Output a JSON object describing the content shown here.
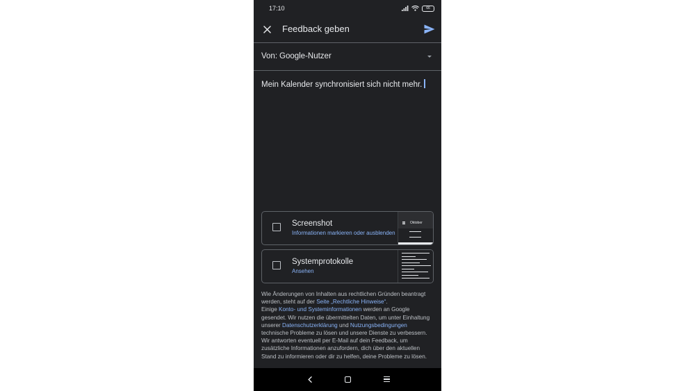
{
  "status_bar": {
    "time": "17:10",
    "battery": "66",
    "icons": [
      "signal-icon",
      "wifi-icon",
      "battery-icon"
    ]
  },
  "app_bar": {
    "close_icon": "close-icon",
    "title": "Feedback geben",
    "send_icon": "send-icon"
  },
  "from": {
    "label": "Von:",
    "value": "Google-Nutzer"
  },
  "feedback": {
    "text": "Mein Kalender synchronisiert sich nicht mehr."
  },
  "attachments": [
    {
      "title": "Screenshot",
      "subtitle": "Informationen markieren oder ausblenden",
      "checked": false,
      "thumbnail_label": "Oktober"
    },
    {
      "title": "Systemprotokolle",
      "subtitle": "Ansehen",
      "checked": false
    }
  ],
  "legal": {
    "p1_a": "Wie Änderungen von Inhalten aus rechtlichen Gründen beantragt werden, steht auf der ",
    "p1_link": "Seite „Rechtliche Hinweise“",
    "p1_b": ".",
    "p2_a": "Einige ",
    "p2_link1": "Konto- und Systeminformationen",
    "p2_b": " werden an Google gesendet. Wir nutzen die übermittelten Daten, um unter Einhaltung unserer ",
    "p2_link2": "Datenschutzerklärung",
    "p2_c": " und ",
    "p2_link3": "Nutzungsbedingungen",
    "p2_d": " technische Probleme zu lösen und unsere Dienste zu verbessern. Wir antworten eventuell per E-Mail auf dein Feedback, um zusätzliche Informationen anzufordern, dich über den aktuellen Stand zu informieren oder dir zu helfen, deine Probleme zu lösen."
  },
  "nav_bar": {
    "icons": [
      "back-icon",
      "home-icon",
      "recents-icon"
    ]
  },
  "colors": {
    "background": "#202124",
    "text": "#e8eaed",
    "link": "#8ab4f8",
    "divider": "#5f6368"
  }
}
